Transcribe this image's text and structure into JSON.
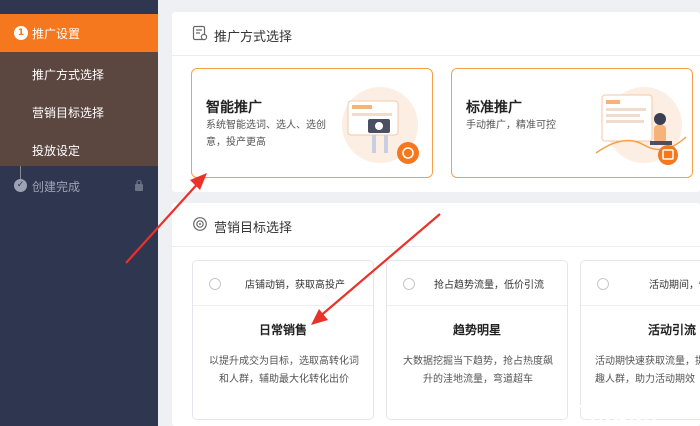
{
  "sidebar": {
    "step_number": "1",
    "active_label": "推广设置",
    "items": [
      "推广方式选择",
      "营销目标选择",
      "投放设定"
    ],
    "done_label": "创建完成"
  },
  "promo_panel": {
    "title": "推广方式选择",
    "cards": [
      {
        "title": "智能推广",
        "desc_line1": "系统智能选词、选人、选创",
        "desc_line2": "意，投产更高"
      },
      {
        "title": "标准推广",
        "desc_line1": "手动推广，精准可控",
        "desc_line2": ""
      }
    ]
  },
  "goal_panel": {
    "title": "营销目标选择",
    "goals": [
      {
        "tag": "店铺动销，获取高投产",
        "title": "日常销售",
        "desc_line1": "以提升成交为目标，选取高转化词",
        "desc_line2": "和人群，辅助最大化转化出价"
      },
      {
        "tag": "抢占趋势流量，低价引流",
        "title": "趋势明星",
        "desc_line1": "大数据挖掘当下趋势，抢占热度飙",
        "desc_line2": "升的洼地流量，弯道超车"
      },
      {
        "tag": "活动期间，快速",
        "title": "活动引流",
        "desc_line1": "活动期快速获取流量，提",
        "desc_line2": "趣人群，助力活动期效"
      }
    ]
  },
  "watermark": "广东龙网",
  "colors": {
    "accent": "#f5781f",
    "sidebar_bg": "#2f3650",
    "arrow": "#e8322a"
  }
}
